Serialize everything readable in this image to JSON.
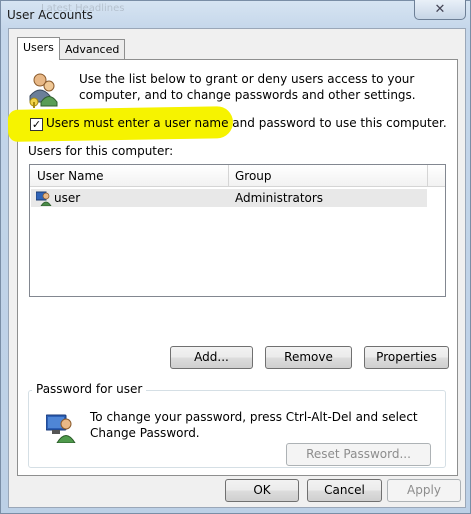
{
  "window": {
    "title": "User Accounts",
    "background_ghost_text": "Latest Headlines"
  },
  "tabs": [
    {
      "label": "Users",
      "active": true
    },
    {
      "label": "Advanced",
      "active": false
    }
  ],
  "users_tab": {
    "intro_text": "Use the list below to grant or deny users access to your computer, and to change passwords and other settings.",
    "checkbox_label": "Users must enter a user name and password to use this computer.",
    "checkbox_checked": true,
    "checkbox_mark": "✓",
    "list_label": "Users for this computer:",
    "columns": [
      "User Name",
      "Group"
    ],
    "rows": [
      {
        "user_name": "user",
        "group": "Administrators"
      }
    ],
    "buttons": {
      "add": "Add...",
      "remove": "Remove",
      "properties": "Properties"
    },
    "password_group": {
      "title": "Password for user",
      "text": "To change your password, press Ctrl-Alt-Del and select Change Password.",
      "reset_button": "Reset Password..."
    }
  },
  "footer_buttons": {
    "ok": "OK",
    "cancel": "Cancel",
    "apply": "Apply"
  },
  "colors": {
    "highlight": "#f6f300",
    "frame": "#c4d6ea"
  },
  "icons": {
    "users": "users-icon",
    "user_row": "user-icon",
    "password": "password-user-icon",
    "close": "close-icon"
  }
}
